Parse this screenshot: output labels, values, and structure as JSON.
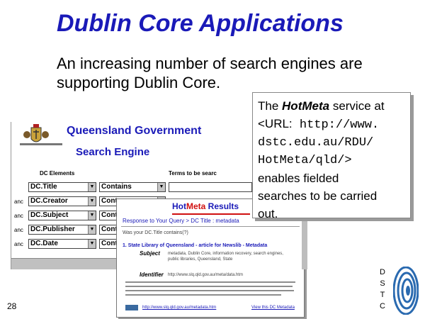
{
  "slide": {
    "title": "Dublin Core Applications",
    "intro": "An increasing number of search engines are supporting Dublin Core.",
    "number": "28"
  },
  "queensland": {
    "title": "Queensland Government",
    "subtitle": "Search Engine",
    "columns": {
      "elements": "DC Elements",
      "terms": "Terms to be searc"
    },
    "connector": "anc",
    "rows": [
      {
        "element": "DC.Title",
        "operator": "Contains"
      },
      {
        "element": "DC.Creator",
        "operator": "Cont"
      },
      {
        "element": "DC.Subject",
        "operator": "Cont"
      },
      {
        "element": "DC.Publisher",
        "operator": "Cont"
      },
      {
        "element": "DC.Date",
        "operator": "Cont"
      }
    ]
  },
  "hotmeta": {
    "logo_hot": "Hot",
    "logo_meta": "Meta",
    "logo_results": " Results",
    "response_line": "Response to Your Query > DC Title : metadata",
    "query_line": "Was your DC.Title contains(?)",
    "result_title": "1. State Library of Queensland - article for Newslib - Metadata",
    "subject_label": "Subject",
    "subject_value": "metadata, Dublin Core, information recovery, search engines, public libraries, Queensland, State",
    "identifier_label": "Identifier",
    "identifier_value": "http://www.slq.qld.gov.au/meta/data.htm",
    "link_text": "http://www.slq.qld.gov.au/metadata.htm",
    "link2_text": "View this DC Metadata"
  },
  "callout": {
    "prefix": "The ",
    "brand": "HotMeta",
    "after_brand": " service at",
    "url_label": "<URL:",
    "url_1": " http://www.",
    "url_2": "dstc.edu.au/RDU/",
    "url_3": "HotMeta/qld/>",
    "rest_1": "enables fielded",
    "rest_2": "searches to be carried",
    "rest_3": "out."
  },
  "dstc": {
    "letters": [
      "D",
      "S",
      "T",
      "C"
    ]
  },
  "colors": {
    "heading_blue": "#1a1ab8",
    "hotmeta_red": "#d01010"
  }
}
